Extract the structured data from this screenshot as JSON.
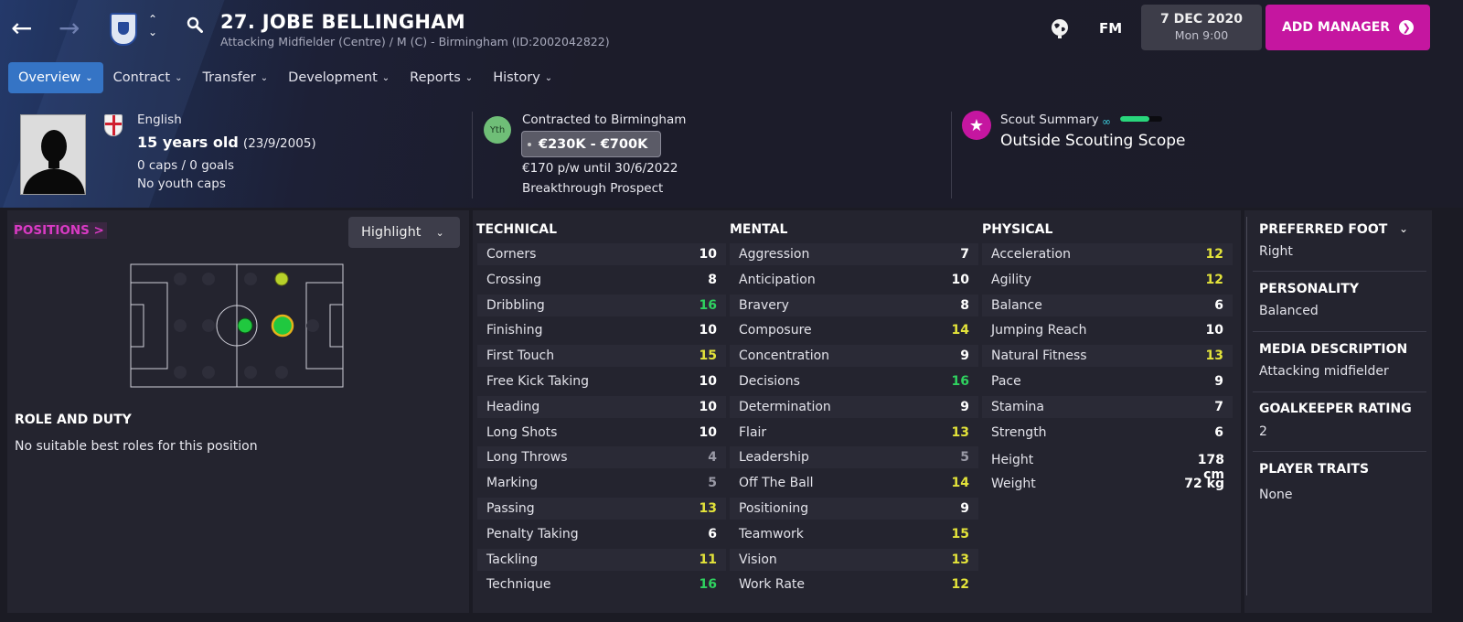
{
  "header": {
    "player_name": "27. JOBE BELLINGHAM",
    "subtitle": "Attacking Midfielder (Centre) / M (C) - Birmingham (ID:2002042822)",
    "fm_label": "FM",
    "date": "7 DEC 2020",
    "time": "Mon 9:00",
    "add_manager": "ADD MANAGER"
  },
  "tabs": [
    {
      "label": "Overview",
      "active": true
    },
    {
      "label": "Contract"
    },
    {
      "label": "Transfer"
    },
    {
      "label": "Development"
    },
    {
      "label": "Reports"
    },
    {
      "label": "History"
    }
  ],
  "profile": {
    "nationality": "English",
    "age": "15 years old",
    "dob": "(23/9/2005)",
    "caps": "0 caps / 0 goals",
    "youth_caps": "No youth caps"
  },
  "contract": {
    "badge": "Yth",
    "contracted": "Contracted to Birmingham",
    "value": "€230K - €700K",
    "wage": "€170 p/w until 30/6/2022",
    "status": "Breakthrough Prospect"
  },
  "scout": {
    "title": "Scout Summary",
    "status": "Outside Scouting Scope",
    "knowledge_fraction": 0.7
  },
  "positions": {
    "label": "POSITIONS >",
    "highlight_label": "Highlight",
    "role_title": "ROLE AND DUTY",
    "role_text": "No suitable best roles for this position"
  },
  "technical": {
    "title": "TECHNICAL",
    "rows": [
      {
        "name": "Corners",
        "value": "10"
      },
      {
        "name": "Crossing",
        "value": "8"
      },
      {
        "name": "Dribbling",
        "value": "16"
      },
      {
        "name": "Finishing",
        "value": "10"
      },
      {
        "name": "First Touch",
        "value": "15"
      },
      {
        "name": "Free Kick Taking",
        "value": "10"
      },
      {
        "name": "Heading",
        "value": "10"
      },
      {
        "name": "Long Shots",
        "value": "10"
      },
      {
        "name": "Long Throws",
        "value": "4"
      },
      {
        "name": "Marking",
        "value": "5"
      },
      {
        "name": "Passing",
        "value": "13"
      },
      {
        "name": "Penalty Taking",
        "value": "6"
      },
      {
        "name": "Tackling",
        "value": "11"
      },
      {
        "name": "Technique",
        "value": "16"
      }
    ]
  },
  "mental": {
    "title": "MENTAL",
    "rows": [
      {
        "name": "Aggression",
        "value": "7"
      },
      {
        "name": "Anticipation",
        "value": "10"
      },
      {
        "name": "Bravery",
        "value": "8"
      },
      {
        "name": "Composure",
        "value": "14"
      },
      {
        "name": "Concentration",
        "value": "9"
      },
      {
        "name": "Decisions",
        "value": "16"
      },
      {
        "name": "Determination",
        "value": "9"
      },
      {
        "name": "Flair",
        "value": "13"
      },
      {
        "name": "Leadership",
        "value": "5"
      },
      {
        "name": "Off The Ball",
        "value": "14"
      },
      {
        "name": "Positioning",
        "value": "9"
      },
      {
        "name": "Teamwork",
        "value": "15"
      },
      {
        "name": "Vision",
        "value": "13"
      },
      {
        "name": "Work Rate",
        "value": "12"
      }
    ]
  },
  "physical": {
    "title": "PHYSICAL",
    "rows": [
      {
        "name": "Acceleration",
        "value": "12"
      },
      {
        "name": "Agility",
        "value": "12"
      },
      {
        "name": "Balance",
        "value": "6"
      },
      {
        "name": "Jumping Reach",
        "value": "10"
      },
      {
        "name": "Natural Fitness",
        "value": "13"
      },
      {
        "name": "Pace",
        "value": "9"
      },
      {
        "name": "Stamina",
        "value": "7"
      },
      {
        "name": "Strength",
        "value": "6"
      }
    ],
    "height_label": "Height",
    "height": "178 cm",
    "weight_label": "Weight",
    "weight": "72 kg"
  },
  "side": {
    "foot_label": "PREFERRED FOOT",
    "foot": "Right",
    "personality_label": "PERSONALITY",
    "personality": "Balanced",
    "media_label": "MEDIA DESCRIPTION",
    "media": "Attacking midfielder",
    "gk_label": "GOALKEEPER RATING",
    "gk": "2",
    "traits_label": "PLAYER TRAITS",
    "traits": "None"
  },
  "colors": {
    "accent_blue": "#3574c5",
    "accent_magenta": "#c516a0",
    "attr_green": "#2fd15f",
    "attr_yellow": "#e3e33a",
    "attr_white": "#ffffff",
    "attr_grey": "#9a9aa6"
  }
}
